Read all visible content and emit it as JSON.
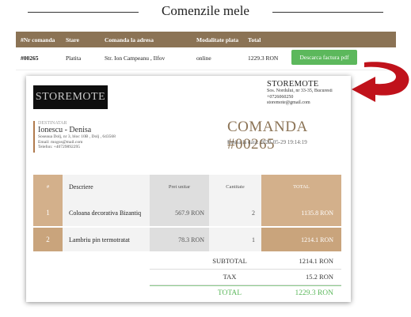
{
  "page_title": "Comenzile mele",
  "orders": {
    "headers": [
      "#Nr comanda",
      "Stare",
      "Comanda la adresa",
      "Modalitate plata",
      "Total"
    ],
    "rows": [
      {
        "nr": "#00265",
        "status": "Platita",
        "address": "Str. Ion Campeanu , Ilfov",
        "payment": "online",
        "total": "1229.3 RON",
        "action": "Descarca factura pdf"
      }
    ]
  },
  "invoice": {
    "logo_text": "STOREMOTE",
    "store": {
      "name": "STOREMOTE",
      "address": "Sos. Nordului, nr 33-35, Bucuresti",
      "phone": "+0726060250",
      "email": "storemote@gmail.com"
    },
    "recipient": {
      "label": "DESTINATAR",
      "name": "Ionescu - Denisa",
      "address": "Soseaua Dolj, nr 3, bloc 10B , Dolj , 643568",
      "email": "Email: mogos@mail.com",
      "phone": "Telefon: +40729892295"
    },
    "title": "COMANDA #00265",
    "date": "Emisa la data: 2020-05-29 19:14:19",
    "columns": [
      "#",
      "Descriere",
      "Pret unitar",
      "Cantitate",
      "TOTAL"
    ],
    "items": [
      {
        "num": "1",
        "description": "Coloana decorativa Bizantiq",
        "unit_price": "567.9 RON",
        "qty": "2",
        "total": "1135.8 RON"
      },
      {
        "num": "2",
        "description": "Lambriu pin termotratat",
        "unit_price": "78.3 RON",
        "qty": "1",
        "total": "1214.1 RON"
      }
    ],
    "totals": {
      "subtotal_label": "SUBTOTAL",
      "subtotal": "1214.1 RON",
      "tax_label": "TAX",
      "tax": "15.2 RON",
      "total_label": "TOTAL",
      "total": "1229.3 RON"
    }
  },
  "colors": {
    "header_brown": "#8b7355",
    "accent_tan": "#d3b08b",
    "button_green": "#5cb85c",
    "arrow_red": "#c0121b"
  }
}
